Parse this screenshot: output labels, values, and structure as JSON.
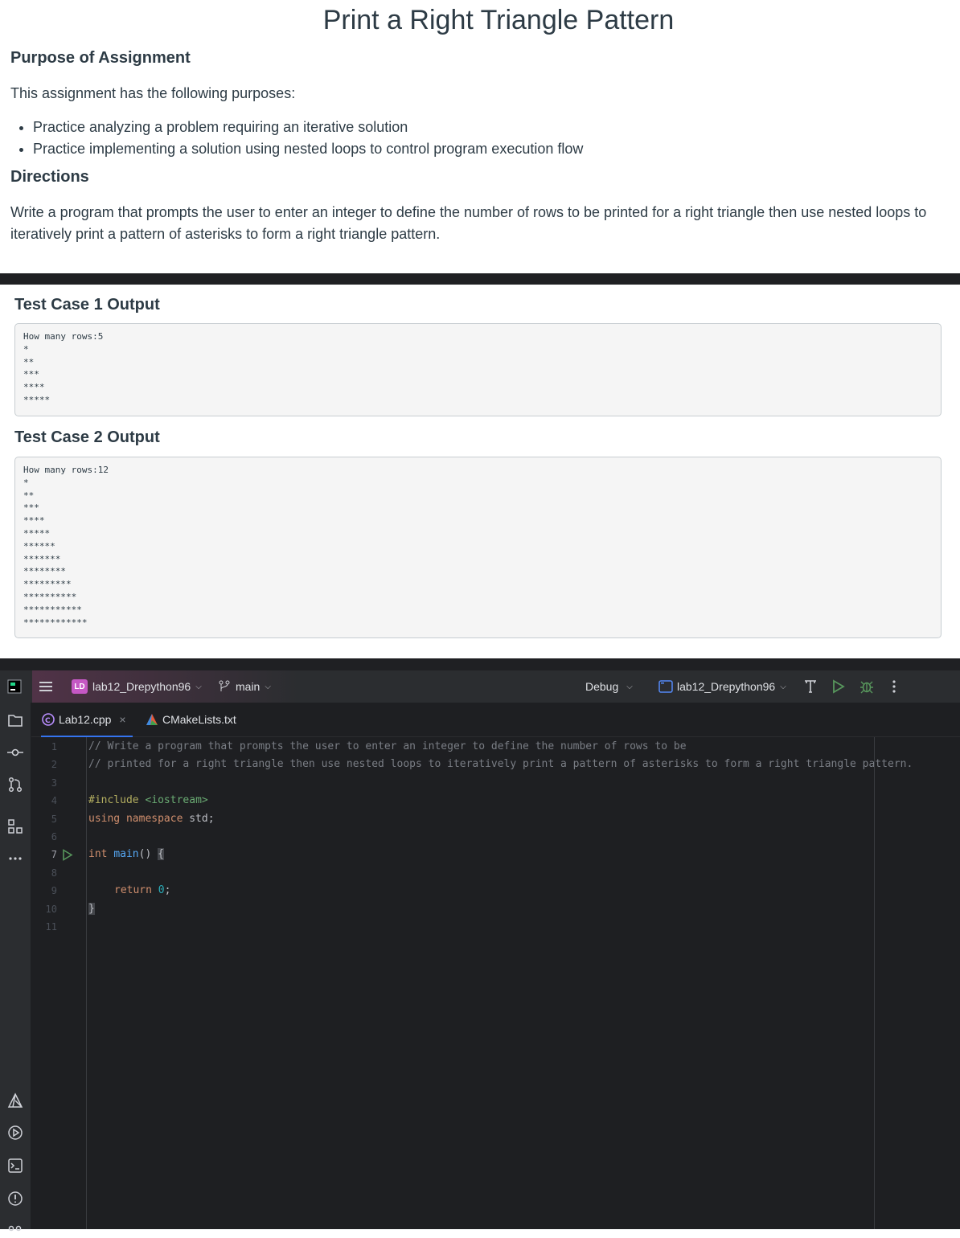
{
  "assignment": {
    "title": "Print a Right Triangle Pattern",
    "purpose_heading": "Purpose of Assignment",
    "purpose_intro": "This assignment has the following purposes:",
    "purposes": [
      "Practice analyzing a problem requiring an iterative solution",
      "Practice implementing a solution using nested loops to control program execution flow"
    ],
    "directions_heading": "Directions",
    "directions_text": "Write a program that prompts the user to enter an integer to define the number of rows to be printed for a right triangle then use nested loops to iteratively print a pattern of asterisks to form a right triangle pattern."
  },
  "tests": [
    {
      "title": "Test Case 1 Output",
      "output": "How many rows:5\n*\n**\n***\n****\n*****"
    },
    {
      "title": "Test Case 2 Output",
      "output": "How many rows:12\n*\n**\n***\n****\n*****\n******\n*******\n********\n*********\n**********\n***********\n************"
    }
  ],
  "ide": {
    "project_badge": "LD",
    "project_name": "lab12_Drepython96",
    "branch": "main",
    "run_config": "Debug",
    "target_name": "lab12_Drepython96",
    "tabs": [
      {
        "label": "Lab12.cpp",
        "close": "×"
      },
      {
        "label": "CMakeLists.txt"
      }
    ],
    "line_numbers": [
      "1",
      "2",
      "3",
      "4",
      "5",
      "6",
      "7",
      "8",
      "9",
      "10",
      "11"
    ],
    "code": {
      "l1": "// Write a program that prompts the user to enter an integer to define the number of rows to be",
      "l2": "// printed for a right triangle then use nested loops to iteratively print a pattern of asterisks to form a right triangle pattern.",
      "l4_directive": "#include ",
      "l4_header": "<iostream>",
      "l5_kw": "using namespace",
      "l5_rest": " std;",
      "l7_kw": "int",
      "l7_fn": "main",
      "l7_rest": "() ",
      "l7_brace": "{",
      "l9_kw": "return",
      "l9_num": "0",
      "l9_semi": ";",
      "l10_brace": "}"
    },
    "icons": {
      "left": [
        "folder-icon",
        "commit-icon",
        "pull-requests-icon",
        "structure-icon",
        "more-icon"
      ],
      "left_bottom": [
        "cmake-icon",
        "services-icon",
        "terminal-icon",
        "problems-icon",
        "version-control-icon"
      ]
    },
    "colors": {
      "run_green": "#57965c",
      "badge_pink": "#c558c4",
      "accent_blue": "#3574f0"
    }
  }
}
